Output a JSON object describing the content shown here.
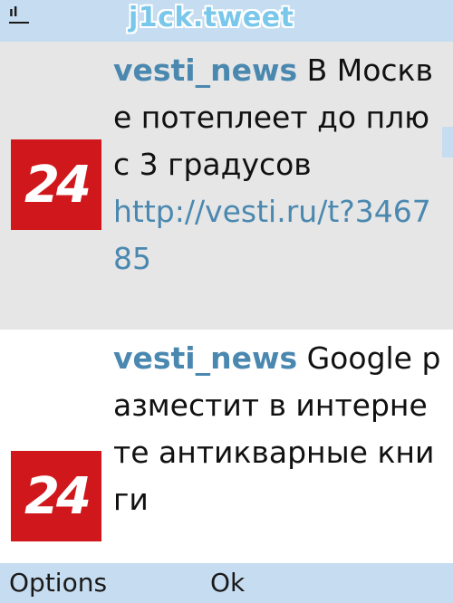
{
  "header": {
    "app_title": "j1ck.tweet",
    "signal_icon": "signal-icon"
  },
  "tweets": [
    {
      "user": "vesti_news",
      "text": " В Москве потеплеет до плюс 3 градусов",
      "link": "http://vesti.ru/t?346785",
      "avatar_label": "24"
    },
    {
      "user": "vesti_news",
      "text": " Google разместит в интернете антикварные книги",
      "link": "",
      "avatar_label": "24"
    }
  ],
  "softkeys": {
    "left": "Options",
    "middle": "Ok"
  },
  "colors": {
    "bar": "#c6dcf0",
    "selected_row": "#e6e6e6",
    "username": "#4a88b0",
    "avatar_bg": "#d0181c"
  }
}
